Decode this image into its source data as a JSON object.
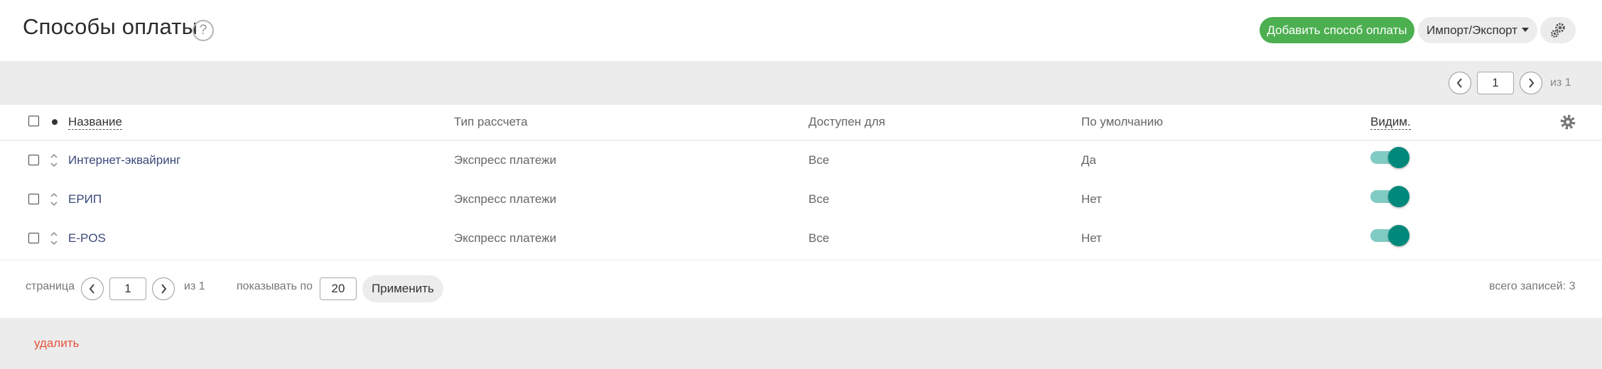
{
  "header": {
    "title": "Способы оплаты",
    "help_symbol": "?",
    "add_button": "Добавить способ оплаты",
    "import_export_button": "Импорт/Экспорт"
  },
  "top_pager": {
    "page": "1",
    "of_label": "из 1"
  },
  "table": {
    "columns": [
      "Название",
      "Тип рассчета",
      "Доступен для",
      "По умолчанию",
      "Видим."
    ],
    "rows": [
      {
        "name": "Интернет-эквайринг",
        "type": "Экспресс платежи",
        "available": "Все",
        "default": "Да",
        "visible": true
      },
      {
        "name": "ЕРИП",
        "type": "Экспресс платежи",
        "available": "Все",
        "default": "Нет",
        "visible": true
      },
      {
        "name": "E-POS",
        "type": "Экспресс платежи",
        "available": "Все",
        "default": "Нет",
        "visible": true
      }
    ]
  },
  "bottom_pager": {
    "page_label": "страница",
    "page": "1",
    "of_label": "из 1",
    "per_page_label": "показывать по",
    "per_page": "20",
    "apply_button": "Применить",
    "total_label": "всего записей: 3"
  },
  "footer": {
    "delete_link": "удалить"
  },
  "colors": {
    "accent_green": "#4caf50",
    "toggle_on": "#00897b",
    "toggle_track": "#80cbc4",
    "delete_red": "#e5533c",
    "link_blue": "#3b4a7a"
  },
  "icons": [
    "help-icon",
    "caret-down-icon",
    "cogs-icon",
    "chevron-left-icon",
    "chevron-right-icon",
    "sort-icon",
    "gear-icon"
  ]
}
